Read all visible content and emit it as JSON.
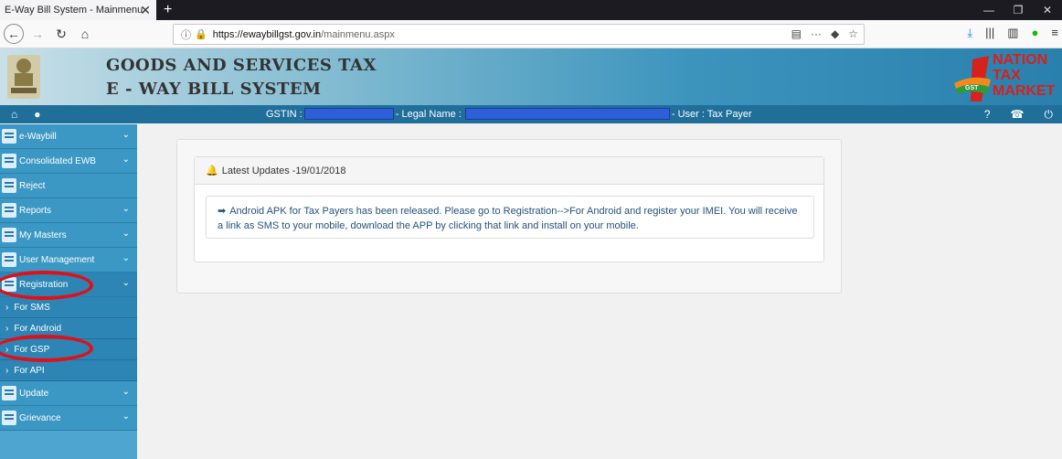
{
  "browser": {
    "tab_title": "E-Way Bill System - Mainmenu",
    "tab_close": "✕",
    "new_tab": "+",
    "url_domain": "https://ewaybillgst.gov.in",
    "url_path": "/mainmenu.aspx",
    "window_controls": [
      "—",
      "❐",
      "✕"
    ]
  },
  "header": {
    "title_line1": "GOODS AND SERVICES TAX",
    "title_line2": "E - WAY BILL SYSTEM",
    "logo_line1": "NATION",
    "logo_line2": "TAX",
    "logo_line3": "MARKET",
    "logo_badge": "GST"
  },
  "info_bar": {
    "gstin_label": "GSTIN :",
    "legal_name_label": "- Legal Name :",
    "user_label": "- User : Tax Payer"
  },
  "sidebar": {
    "items": [
      {
        "label": "e-Waybill"
      },
      {
        "label": "Consolidated EWB"
      },
      {
        "label": "Reject"
      },
      {
        "label": "Reports"
      },
      {
        "label": "My Masters"
      },
      {
        "label": "User Management"
      },
      {
        "label": "Registration"
      }
    ],
    "sub_items": [
      {
        "label": "For SMS"
      },
      {
        "label": "For Android"
      },
      {
        "label": "For GSP"
      },
      {
        "label": "For API"
      }
    ],
    "bottom_items": [
      {
        "label": "Update"
      },
      {
        "label": "Grievance"
      }
    ]
  },
  "updates": {
    "heading": "Latest Updates -19/01/2018",
    "message": "Android APK for Tax Payers has been released. Please go to Registration-->For Android and register your IMEI. You will receive a link as SMS to your mobile, download the APP by clicking that link and install on your mobile."
  },
  "colors": {
    "sidebar": "#3b97c3",
    "info_bar": "#1f6f9a",
    "annotation_ring": "#e0101a",
    "link_text": "#23527c"
  }
}
